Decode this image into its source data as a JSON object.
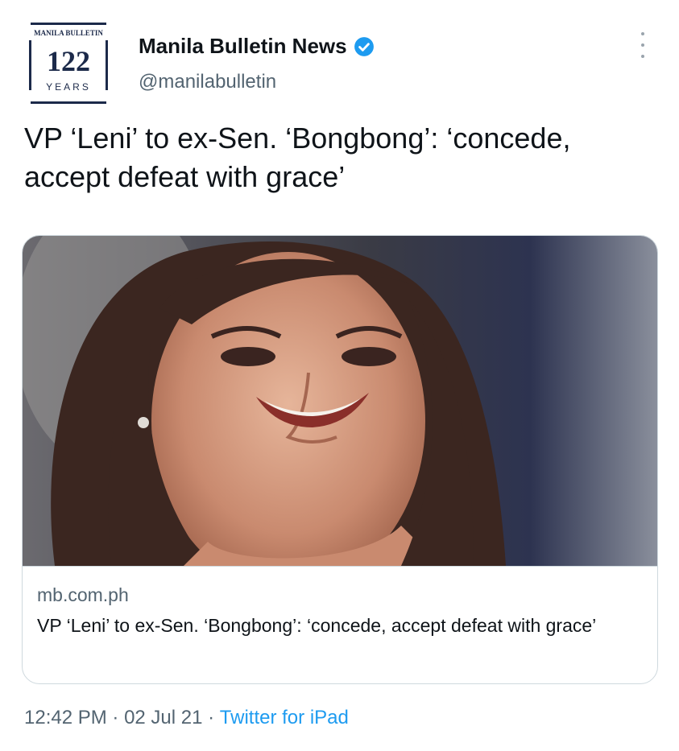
{
  "account": {
    "display_name": "Manila Bulletin News",
    "handle": "@manilabulletin",
    "avatar_logo": {
      "masthead": "MANILA BULLETIN",
      "number": "122",
      "word": "YEARS"
    },
    "verified_icon": "verified-badge-icon"
  },
  "tweet": {
    "text": "VP ‘Leni’ to ex-Sen. ‘Bongbong’: ‘concede, accept defeat with grace’"
  },
  "card": {
    "domain": "mb.com.ph",
    "title": "VP ‘Leni’ to ex-Sen. ‘Bongbong’: ‘concede, accept defeat with grace’",
    "image_description_icon": "news-photo"
  },
  "meta": {
    "time": "12:42 PM",
    "sep1": " · ",
    "date": "02 Jul 21",
    "sep2": " · ",
    "source": "Twitter for iPad"
  },
  "colors": {
    "text": "#0f1419",
    "secondary": "#536471",
    "link": "#1d9bf0",
    "verified": "#1d9bf0",
    "border": "#cfd9de"
  }
}
